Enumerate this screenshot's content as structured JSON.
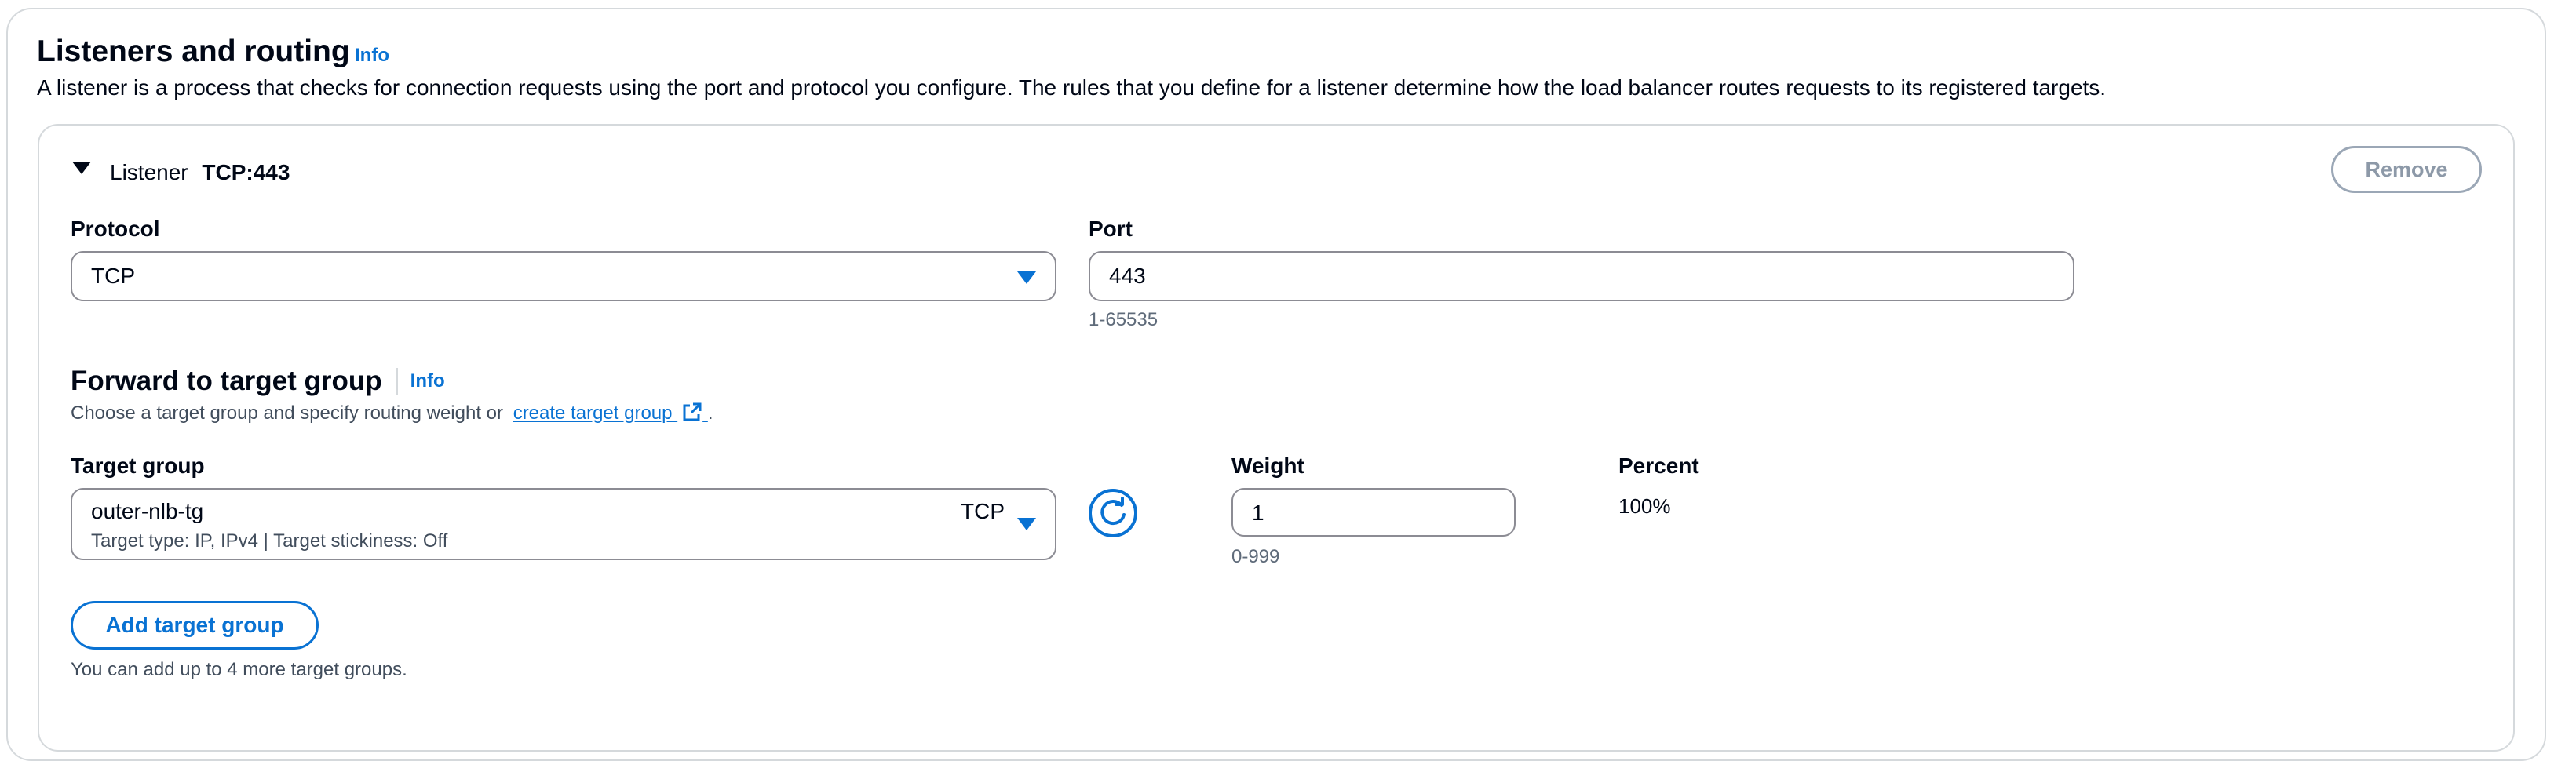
{
  "section": {
    "title": "Listeners and routing",
    "info_label": "Info",
    "description": "A listener is a process that checks for connection requests using the port and protocol you configure. The rules that you define for a listener determine how the load balancer routes requests to its registered targets."
  },
  "listener": {
    "prefix": "Listener",
    "name": "TCP:443",
    "remove_label": "Remove",
    "protocol": {
      "label": "Protocol",
      "value": "TCP"
    },
    "port": {
      "label": "Port",
      "value": "443",
      "hint": "1-65535"
    }
  },
  "forward": {
    "title": "Forward to target group",
    "info_label": "Info",
    "description_before": "Choose a target group and specify routing weight or",
    "create_link": "create target group",
    "description_after": ".",
    "target_group": {
      "label": "Target group",
      "name": "outer-nlb-tg",
      "protocol": "TCP",
      "details": "Target type: IP, IPv4 | Target stickiness: Off"
    },
    "weight": {
      "label": "Weight",
      "value": "1",
      "hint": "0-999"
    },
    "percent": {
      "label": "Percent",
      "value": "100%"
    },
    "add_label": "Add target group",
    "add_hint": "You can add up to 4 more target groups."
  },
  "icons": {
    "expand": "caret-down-icon",
    "select": "select-caret-icon",
    "refresh": "refresh-icon",
    "external": "external-link-icon"
  },
  "colors": {
    "accent": "#0972d3",
    "text": "#000716",
    "border": "#8c8c94",
    "muted": "#5f6b7a"
  }
}
